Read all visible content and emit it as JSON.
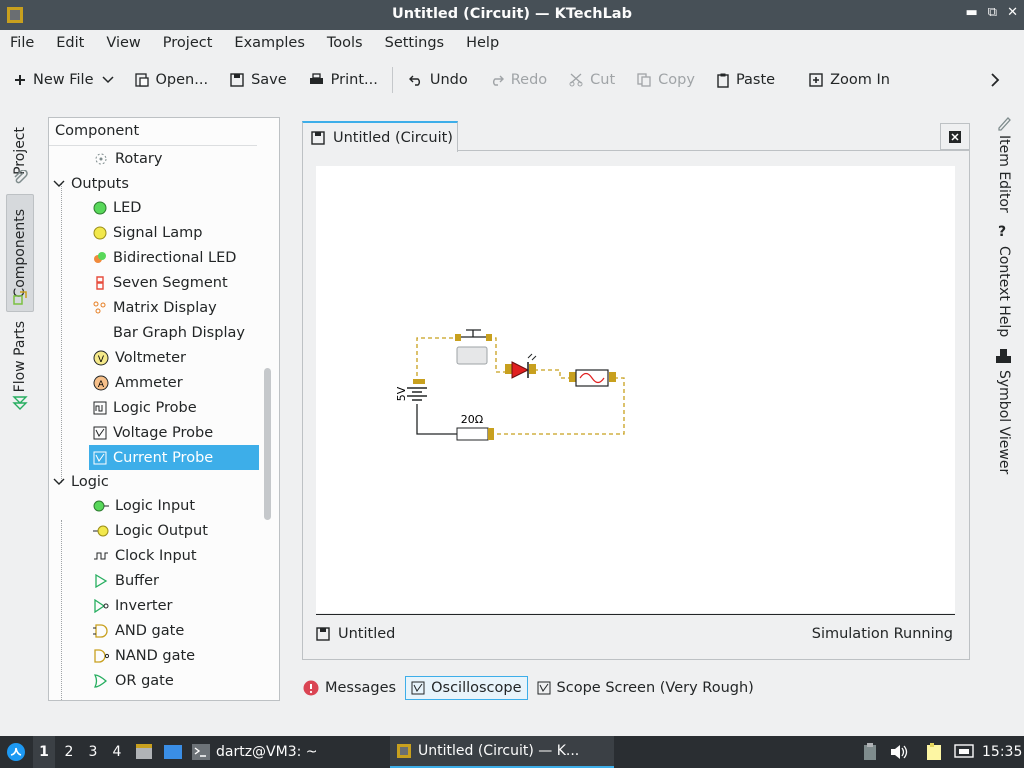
{
  "window": {
    "title": "Untitled (Circuit) — KTechLab"
  },
  "menu": [
    "File",
    "Edit",
    "View",
    "Project",
    "Examples",
    "Tools",
    "Settings",
    "Help"
  ],
  "toolbar": {
    "new_file": "New File",
    "open": "Open...",
    "save": "Save",
    "print": "Print...",
    "undo": "Undo",
    "redo": "Redo",
    "cut": "Cut",
    "copy": "Copy",
    "paste": "Paste",
    "zoom_in": "Zoom In"
  },
  "left_dock": {
    "project": "Project",
    "components": "Components",
    "flow_parts": "Flow Parts"
  },
  "component_panel": {
    "header": "Component",
    "items": [
      {
        "label": "Rotary",
        "icon": "rotary-icon"
      },
      {
        "label": "Outputs",
        "icon": "group"
      },
      {
        "label": "LED",
        "icon": "led-icon"
      },
      {
        "label": "Signal Lamp",
        "icon": "lamp-icon"
      },
      {
        "label": "Bidirectional LED",
        "icon": "bidir-led-icon"
      },
      {
        "label": "Seven Segment",
        "icon": "seven-segment-icon"
      },
      {
        "label": "Matrix Display",
        "icon": "matrix-icon"
      },
      {
        "label": "Bar Graph Display",
        "icon": "none"
      },
      {
        "label": "Voltmeter",
        "icon": "voltmeter-icon"
      },
      {
        "label": "Ammeter",
        "icon": "ammeter-icon"
      },
      {
        "label": "Logic Probe",
        "icon": "probe-icon"
      },
      {
        "label": "Voltage Probe",
        "icon": "probe-icon"
      },
      {
        "label": "Current Probe",
        "icon": "probe-icon"
      },
      {
        "label": "Logic",
        "icon": "group"
      },
      {
        "label": "Logic Input",
        "icon": "logic-in-icon"
      },
      {
        "label": "Logic Output",
        "icon": "logic-out-icon"
      },
      {
        "label": "Clock Input",
        "icon": "clock-icon"
      },
      {
        "label": "Buffer",
        "icon": "buffer-icon"
      },
      {
        "label": "Inverter",
        "icon": "inverter-icon"
      },
      {
        "label": "AND gate",
        "icon": "and-icon"
      },
      {
        "label": "NAND gate",
        "icon": "nand-icon"
      },
      {
        "label": "OR gate",
        "icon": "or-icon"
      }
    ],
    "selected": "Current Probe"
  },
  "document": {
    "tab": "Untitled (Circuit)",
    "status_left": "Untitled",
    "status_right": "Simulation Running"
  },
  "circuit": {
    "battery_label": "5V",
    "resistor_label": "20Ω"
  },
  "bottom_tabs": {
    "messages": "Messages",
    "oscilloscope": "Oscilloscope",
    "scope_screen": "Scope Screen (Very Rough)"
  },
  "right_dock": {
    "item_editor": "Item Editor",
    "context_help": "Context Help",
    "symbol_viewer": "Symbol Viewer"
  },
  "taskbar": {
    "desktops": [
      "1",
      "2",
      "3",
      "4"
    ],
    "terminal": "dartz@VM3: ~",
    "window": "Untitled (Circuit) — K...",
    "clock": "15:35"
  },
  "colors": {
    "accent": "#3daee9",
    "titlebar": "#475057",
    "taskbar": "#2a2e32",
    "wire": "#c8a01e"
  }
}
